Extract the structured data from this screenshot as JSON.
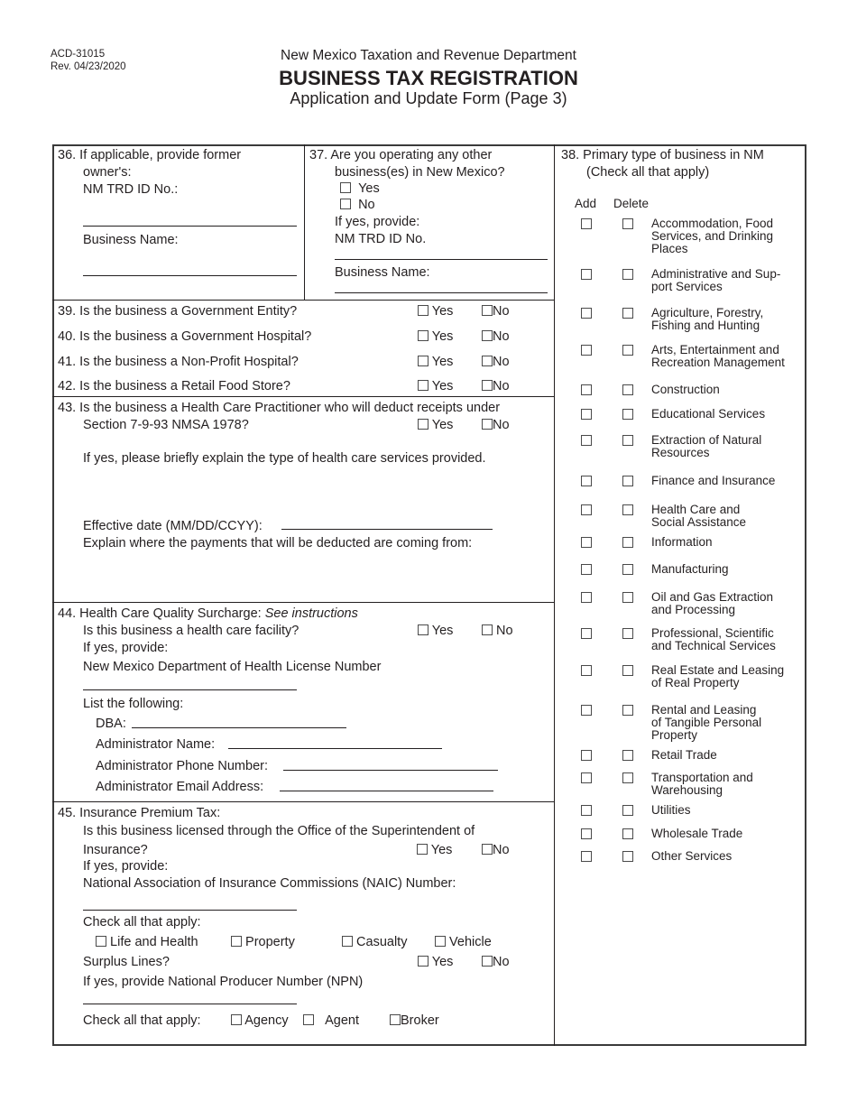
{
  "header": {
    "form_number": "ACD-31015",
    "revision": "Rev. 04/23/2020",
    "department": "New Mexico Taxation and Revenue Department",
    "title": "BUSINESS TAX REGISTRATION",
    "subtitle": "Application and Update Form (Page 3)"
  },
  "q36": {
    "line1": "36. If applicable, provide former",
    "line2": "owner's:",
    "id_label": "NM TRD ID No.:",
    "name_label": "Business Name:"
  },
  "q37": {
    "line1": "37. Are you operating any other",
    "line2": "business(es) in New Mexico?",
    "yes": "Yes",
    "no": "No",
    "if_yes": "If yes, provide:",
    "id_label": "NM TRD ID No.",
    "name_label": "Business Name:"
  },
  "yes_no_questions": [
    {
      "text": "39. Is the business a Government Entity?",
      "yes": "Yes",
      "no": "No"
    },
    {
      "text": "40. Is the business a Government Hospital?",
      "yes": "Yes",
      "no": "No"
    },
    {
      "text": "41. Is the business a Non-Profit Hospital?",
      "yes": "Yes",
      "no": "No"
    },
    {
      "text": "42. Is the business a Retail Food Store?",
      "yes": "Yes",
      "no": "No"
    }
  ],
  "q43": {
    "line1": "43. Is the business a Health Care Practitioner who will deduct receipts under",
    "line2": "Section 7-9-93 NMSA 1978?",
    "yes": "Yes",
    "no": "No",
    "explain": "If yes, please briefly explain the type of health care services provided.",
    "effective_date": "Effective date (MM/DD/CCYY):",
    "payments": "Explain where the payments that will be deducted are coming from:"
  },
  "q44": {
    "title": "44. Health Care Quality Surcharge:",
    "title_italic": "See instructions",
    "facility_q": "Is this business a health care facility?",
    "yes": "Yes",
    "no": "No",
    "if_yes": "If yes, provide:",
    "license": "New Mexico Department of Health License Number",
    "list": "List the following:",
    "dba": "DBA:",
    "admin_name": "Administrator Name:",
    "admin_phone": "Administrator Phone Number:",
    "admin_email": "Administrator Email Address:"
  },
  "q45": {
    "title": "45. Insurance Premium Tax:",
    "licensed_q1": "Is this business licensed through the Office of the Superintendent of",
    "licensed_q2": "Insurance?",
    "yes": "Yes",
    "no": "No",
    "if_yes": "If yes, provide:",
    "naic": "National Association of Insurance Commissions (NAIC) Number:",
    "check_all": "Check all that apply:",
    "types": [
      "Life and Health",
      "Property",
      "Casualty",
      "Vehicle"
    ],
    "surplus": "Surplus Lines?",
    "npn": "If yes, provide National Producer Number (NPN)",
    "check_all2": "Check all that apply:",
    "roles": [
      "Agency",
      "Agent",
      "Broker"
    ]
  },
  "q38": {
    "line1": "38. Primary type of business in NM",
    "line2": "(Check all that apply)",
    "add": "Add",
    "delete": "Delete",
    "categories": [
      "Accommodation, Food Services, and Drinking Places",
      "Administrative and Sup-port Services",
      "Agriculture, Forestry, Fishing and Hunting",
      "Arts, Entertainment and Recreation Management",
      "Construction",
      "Educational Services",
      "Extraction of Natural Resources",
      "Finance and Insurance",
      "Health Care and Social Assistance",
      "Information",
      "Manufacturing",
      "Oil and Gas Extraction and Processing",
      "Professional, Scientific and Technical Services",
      "Real Estate and Leasing of Real Property",
      "Rental and Leasing of Tangible Personal Property",
      "Retail Trade",
      "Transportation and Warehousing",
      "Utilities",
      "Wholesale Trade",
      "Other Services"
    ]
  }
}
